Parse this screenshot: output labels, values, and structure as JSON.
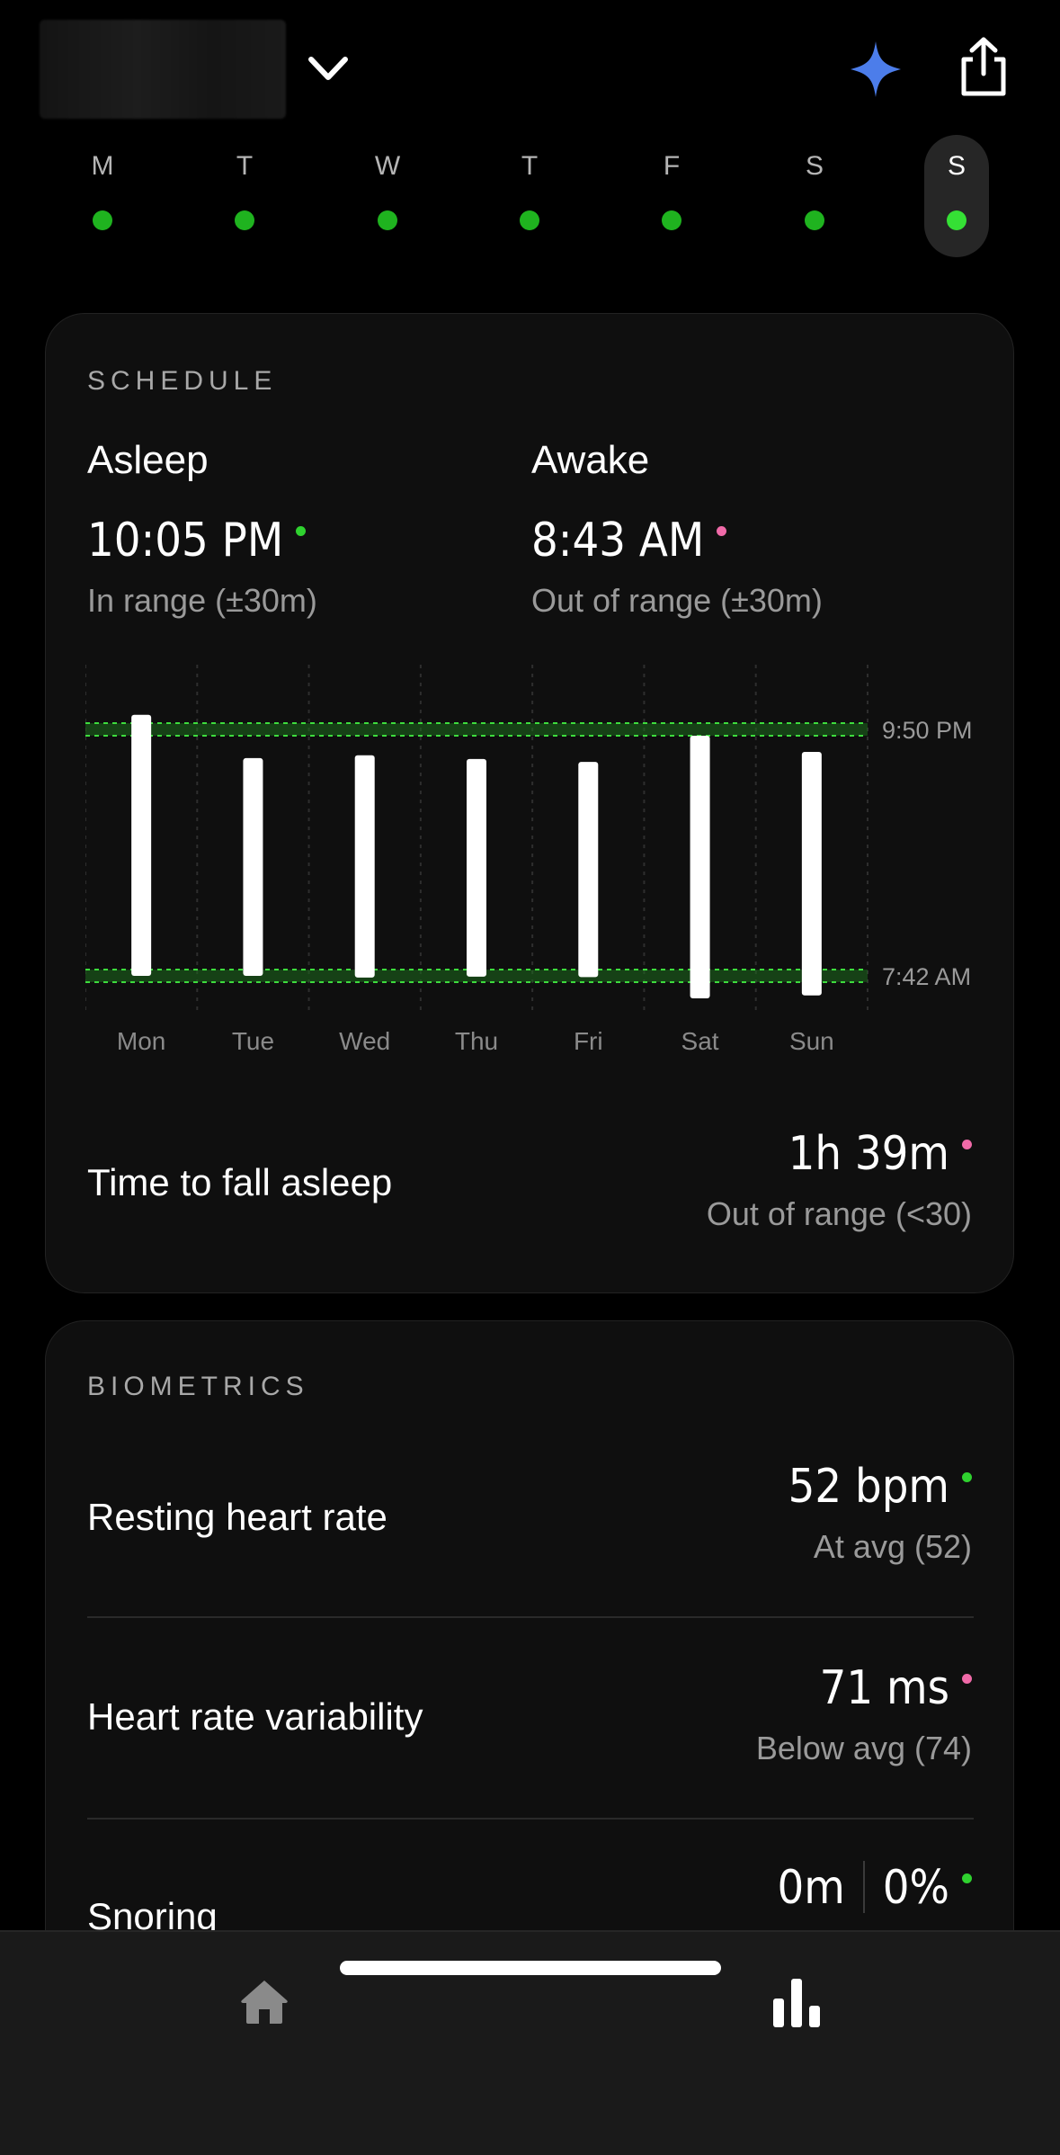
{
  "colors": {
    "good": "#2fd22f",
    "bad": "#f06aa8",
    "sparkle": "#4c7dea",
    "bar": "#ffffff",
    "range_band": "#2bbf2b"
  },
  "header": {
    "icons": [
      "chevron-down-icon",
      "sparkle-icon",
      "share-icon"
    ]
  },
  "week": [
    {
      "label": "M",
      "selected": false
    },
    {
      "label": "T",
      "selected": false
    },
    {
      "label": "W",
      "selected": false
    },
    {
      "label": "T",
      "selected": false
    },
    {
      "label": "F",
      "selected": false
    },
    {
      "label": "S",
      "selected": false
    },
    {
      "label": "S",
      "selected": true
    }
  ],
  "schedule": {
    "title": "SCHEDULE",
    "asleep": {
      "label": "Asleep",
      "time": "10:05 PM",
      "status": "In range (±30m)",
      "status_color": "good"
    },
    "awake": {
      "label": "Awake",
      "time": "8:43 AM",
      "status": "Out of range (±30m)",
      "status_color": "bad"
    },
    "time_to_fall_asleep": {
      "label": "Time to fall asleep",
      "value": "1h 39m",
      "status": "Out of range (<30)",
      "status_color": "bad"
    }
  },
  "chart_data": {
    "type": "bar",
    "orientation": "vertical-range",
    "categories": [
      "Mon",
      "Tue",
      "Wed",
      "Thu",
      "Fri",
      "Sat",
      "Sun"
    ],
    "y_labels": [
      "9:50 PM",
      "7:42 AM"
    ],
    "bedtime_target": "9:50 PM",
    "waketime_target": "7:42 AM",
    "range_minutes": 30,
    "series": [
      {
        "start_minutes_relative_to_midnight": [
          -165,
          -61,
          -68,
          -59,
          -52,
          -115,
          -76
        ],
        "end_minutes_relative_to_midnight": [
          462,
          462,
          466,
          464,
          465,
          516,
          509
        ]
      }
    ],
    "grid": true
  },
  "biometrics": {
    "title": "BIOMETRICS",
    "items": [
      {
        "label": "Resting heart rate",
        "value": "52 bpm",
        "status": "At avg (52)",
        "status_color": "good"
      },
      {
        "label": "Heart rate variability",
        "value": "71 ms",
        "status": "Below avg (74)",
        "status_color": "bad"
      },
      {
        "label": "Snoring",
        "value_a": "0m",
        "value_b": "0%",
        "status_color": "good"
      }
    ]
  },
  "tabbar": {
    "items": [
      "home-icon",
      "stats-icon"
    ]
  }
}
